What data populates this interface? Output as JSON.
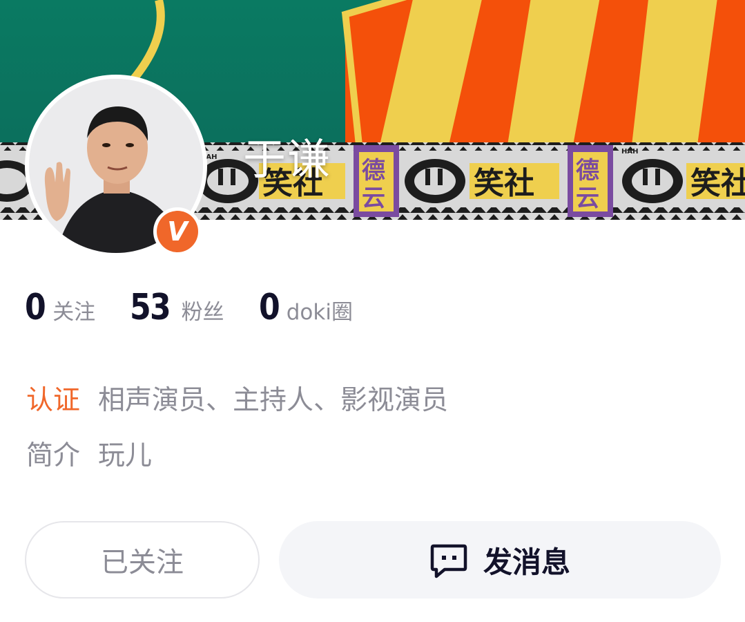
{
  "profile": {
    "name": "于谦",
    "verified_badge": "V"
  },
  "stats": [
    {
      "value": "0",
      "label": "关注"
    },
    {
      "value": "53",
      "label": "粉丝"
    },
    {
      "value": "0",
      "label": "doki圈"
    }
  ],
  "info": {
    "cert_label": "认证",
    "cert_value": "相声演员、主持人、影视演员",
    "intro_label": "简介",
    "intro_value": "玩儿"
  },
  "actions": {
    "followed_label": "已关注",
    "message_label": "发消息"
  },
  "banner": {
    "text_laugh": "笑社",
    "text_de": "德",
    "text_yun": "云",
    "hah": "HAH"
  },
  "colors": {
    "accent_orange": "#f0672a",
    "banner_green": "#0c7a66",
    "stripe_orange": "#f4500a",
    "stripe_yellow": "#efcf4e",
    "text_dark": "#12122a",
    "text_gray": "#8c8c96"
  }
}
